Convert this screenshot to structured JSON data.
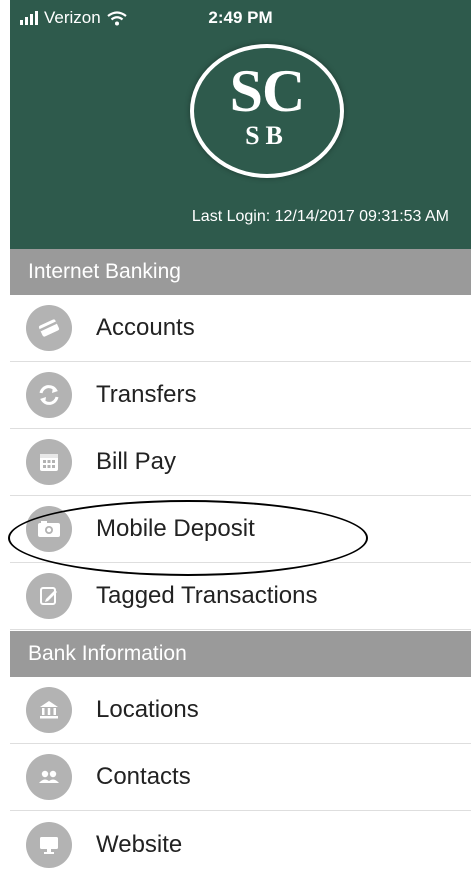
{
  "status_bar": {
    "carrier": "Verizon",
    "time": "2:49 PM"
  },
  "header": {
    "logo_top": "SC",
    "logo_bottom": "SB",
    "last_login": "Last Login: 12/14/2017 09:31:53 AM"
  },
  "sections": {
    "internet_banking": "Internet Banking",
    "bank_information": "Bank Information"
  },
  "menu": {
    "accounts": "Accounts",
    "transfers": "Transfers",
    "bill_pay": "Bill Pay",
    "mobile_deposit": "Mobile Deposit",
    "tagged_transactions": "Tagged Transactions",
    "locations": "Locations",
    "contacts": "Contacts",
    "website": "Website"
  },
  "colors": {
    "header_bg": "#2e5a4c",
    "section_bg": "#9a9a9a",
    "icon_bg": "#b3b3b3"
  }
}
